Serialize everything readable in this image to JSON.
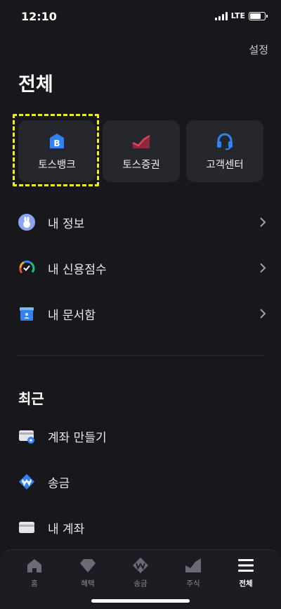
{
  "status_bar": {
    "time": "12:10",
    "network": "LTE",
    "battery_level": 0.75
  },
  "header": {
    "settings_label": "설정",
    "title": "전체"
  },
  "quick_access": [
    {
      "label": "토스뱅크",
      "icon": "toss-bank-icon",
      "color": "#3182f6"
    },
    {
      "label": "토스증권",
      "icon": "toss-securities-icon",
      "color": "#d8355a"
    },
    {
      "label": "고객센터",
      "icon": "headset-icon",
      "color": "#3182f6"
    }
  ],
  "menu": [
    {
      "label": "내 정보",
      "icon": "rabbit-profile-icon"
    },
    {
      "label": "내 신용점수",
      "icon": "credit-gauge-icon"
    },
    {
      "label": "내 문서함",
      "icon": "document-box-icon"
    }
  ],
  "recent": {
    "title": "최근",
    "items": [
      {
        "label": "계좌 만들기",
        "icon": "account-create-icon"
      },
      {
        "label": "송금",
        "icon": "transfer-icon"
      },
      {
        "label": "내 계좌",
        "icon": "account-card-icon"
      }
    ]
  },
  "tab_bar": {
    "active": "전체",
    "tabs": [
      {
        "label": "홈",
        "icon": "home-icon"
      },
      {
        "label": "혜택",
        "icon": "benefit-diamond-icon"
      },
      {
        "label": "송금",
        "icon": "transfer-won-icon"
      },
      {
        "label": "주식",
        "icon": "stock-chart-icon"
      },
      {
        "label": "전체",
        "icon": "menu-icon"
      }
    ]
  },
  "colors": {
    "background": "#17171c",
    "card": "#26262d",
    "accent_blue": "#3182f6",
    "highlight": "#f4ee27"
  }
}
